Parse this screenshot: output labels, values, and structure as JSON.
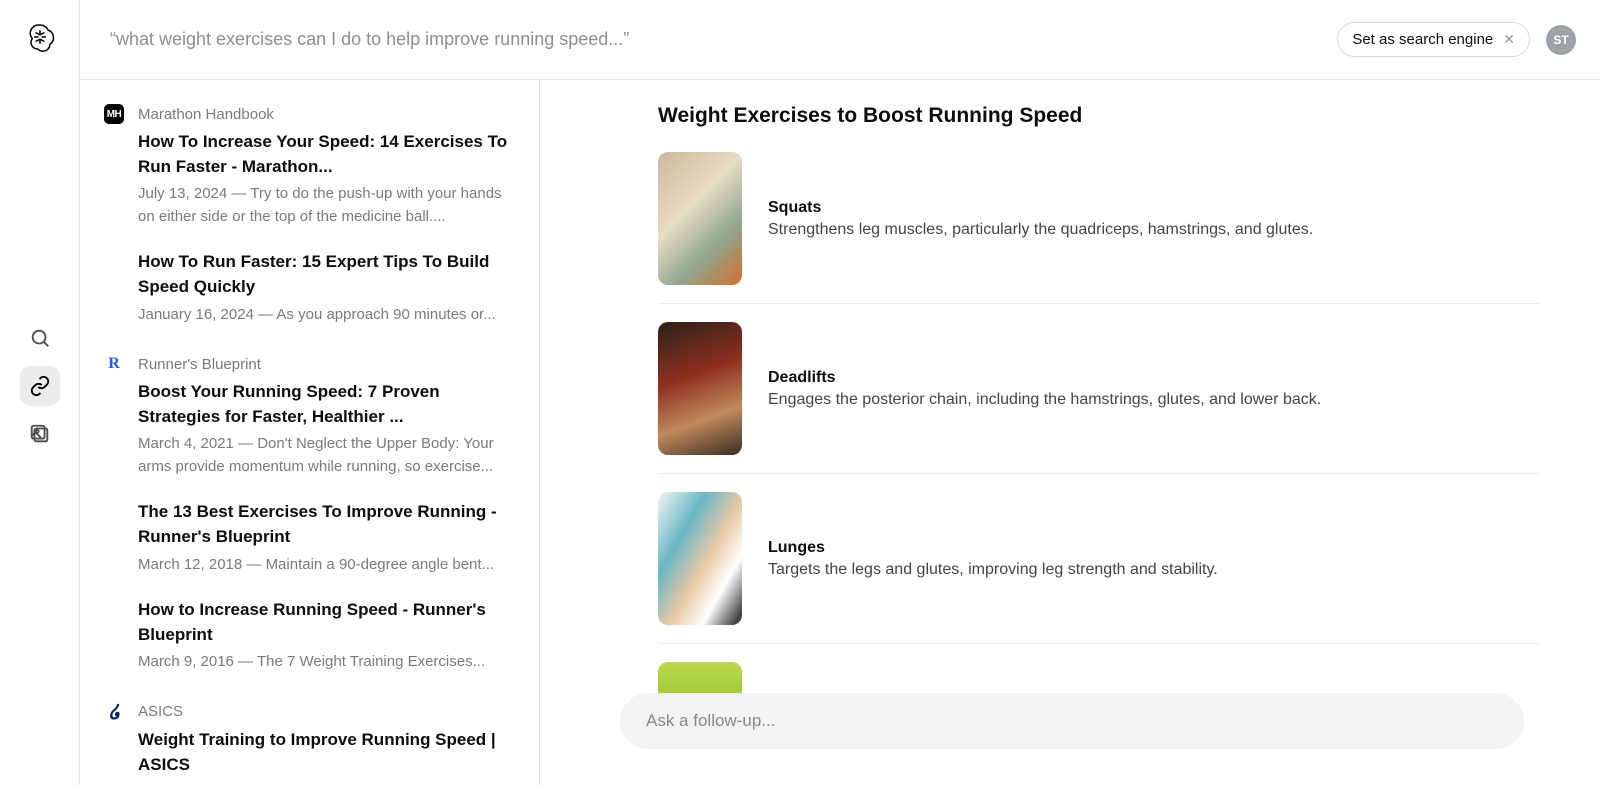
{
  "header": {
    "query_display": "“what weight exercises can I do to help improve running speed...”",
    "set_engine_label": "Set as search engine",
    "avatar_initials": "ST"
  },
  "rail": {
    "items": [
      "search",
      "link",
      "images"
    ],
    "active": "link"
  },
  "sources": [
    {
      "name": "Marathon Handbook",
      "favicon": "MH",
      "favicon_class": "fav-mh",
      "articles": [
        {
          "title": "How To Increase Your Speed: 14 Exercises To Run Faster - Marathon...",
          "snippet": "July 13, 2024 — Try to do the push-up with your hands on either side or the top of the medicine ball...."
        },
        {
          "title": "How To Run Faster: 15 Expert Tips To Build Speed Quickly",
          "snippet": "January 16, 2024 — As you approach 90 minutes or..."
        }
      ]
    },
    {
      "name": "Runner's Blueprint",
      "favicon": "R",
      "favicon_class": "fav-rb",
      "articles": [
        {
          "title": "Boost Your Running Speed: 7 Proven Strategies for Faster, Healthier ...",
          "snippet": "March 4, 2021 — Don't Neglect the Upper Body: Your arms provide momentum while running, so exercise..."
        },
        {
          "title": "The 13 Best Exercises To Improve Running - Runner's Blueprint",
          "snippet": "March 12, 2018 — Maintain a 90-degree angle bent..."
        },
        {
          "title": "How to Increase Running Speed - Runner's Blueprint",
          "snippet": "March 9, 2016 — The 7 Weight Training Exercises..."
        }
      ]
    },
    {
      "name": "ASICS",
      "favicon": "໒",
      "favicon_class": "fav-asics",
      "articles": [
        {
          "title": "Weight Training to Improve Running Speed | ASICS",
          "snippet": ""
        }
      ]
    }
  ],
  "answer": {
    "title": "Weight Exercises to Boost Running Speed",
    "exercises": [
      {
        "name": "Squats",
        "desc": "Strengthens leg muscles, particularly the quadriceps, hamstrings, and glutes.",
        "img": "squats"
      },
      {
        "name": "Deadlifts",
        "desc": "Engages the posterior chain, including the hamstrings, glutes, and lower back.",
        "img": "deadlifts"
      },
      {
        "name": "Lunges",
        "desc": "Targets the legs and glutes, improving leg strength and stability.",
        "img": "lunges"
      }
    ]
  },
  "followup": {
    "placeholder": "Ask a follow-up..."
  }
}
